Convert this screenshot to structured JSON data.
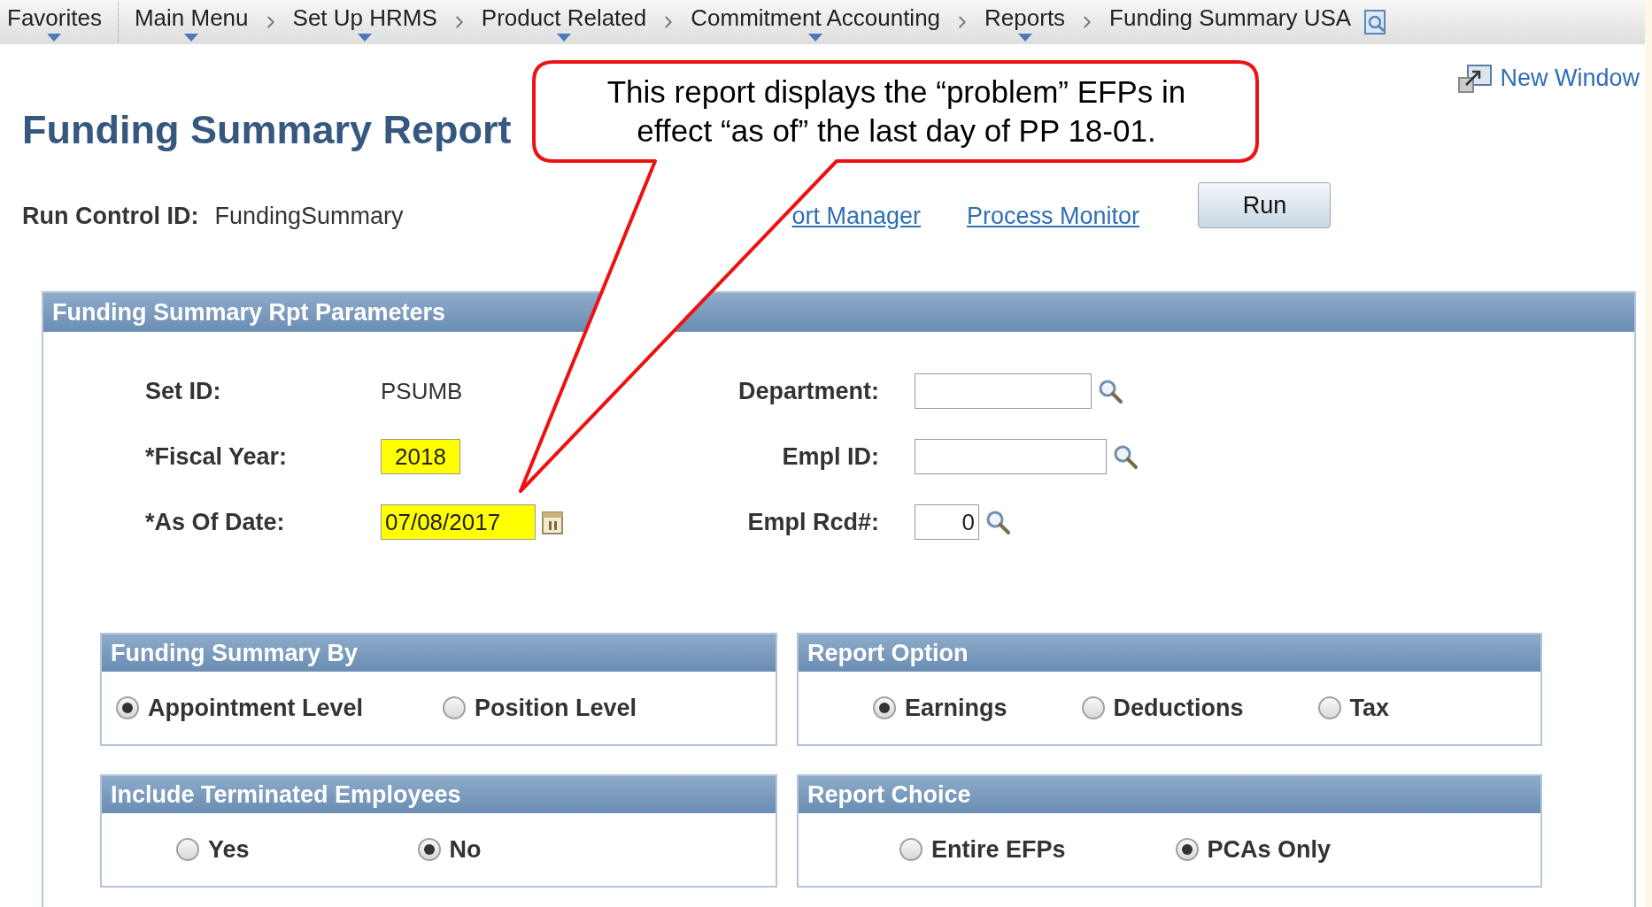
{
  "nav": [
    {
      "label": "Favorites",
      "dropdown": true
    },
    {
      "label": "Main Menu",
      "dropdown": true
    },
    {
      "label": "Set Up HRMS",
      "dropdown": true
    },
    {
      "label": "Product Related",
      "dropdown": true
    },
    {
      "label": "Commitment Accounting",
      "dropdown": true
    },
    {
      "label": "Reports",
      "dropdown": true
    },
    {
      "label": "Funding Summary USA",
      "dropdown": false
    }
  ],
  "new_window": "New Window",
  "title": "Funding Summary Report",
  "run_control": {
    "label": "Run Control ID:",
    "value": "FundingSummary"
  },
  "links": [
    "ort Manager",
    "Process Monitor"
  ],
  "run_button": "Run",
  "callout": {
    "text": "This report displays the “problem” EFPs in effect “as of” the last day of PP 18-01."
  },
  "panel": {
    "title": "Funding Summary Rpt Parameters",
    "left_fields": [
      {
        "label": "Set ID:",
        "value": "PSUMB",
        "kind": "text"
      },
      {
        "label": "*Fiscal Year:",
        "value": "2018",
        "kind": "input",
        "highlighted": true
      },
      {
        "label": "*As Of Date:",
        "value": "07/08/2017",
        "kind": "date",
        "highlighted": true
      }
    ],
    "right_fields": [
      {
        "label": "Department:",
        "kind": "lookup",
        "highlighted": false
      },
      {
        "label": "Empl ID:",
        "kind": "lookup",
        "highlighted": false
      },
      {
        "label": "Empl Rcd#:",
        "value": "0",
        "kind": "lookup",
        "highlighted": false
      }
    ],
    "groups": [
      {
        "title": "Funding Summary By",
        "options": [
          {
            "label": "Appointment Level",
            "selected": true
          },
          {
            "label": "Position Level",
            "selected": false
          }
        ]
      },
      {
        "title": "Report Option",
        "options": [
          {
            "label": "Earnings",
            "selected": true
          },
          {
            "label": "Deductions",
            "selected": false
          },
          {
            "label": "Tax",
            "selected": false
          }
        ]
      },
      {
        "title": "Include Terminated Employees",
        "options": [
          {
            "label": "Yes",
            "selected": false
          },
          {
            "label": "No",
            "selected": true
          }
        ]
      },
      {
        "title": "Report Choice",
        "options": [
          {
            "label": "Entire EFPs",
            "selected": false
          },
          {
            "label": "PCAs Only",
            "selected": true
          }
        ]
      }
    ]
  }
}
